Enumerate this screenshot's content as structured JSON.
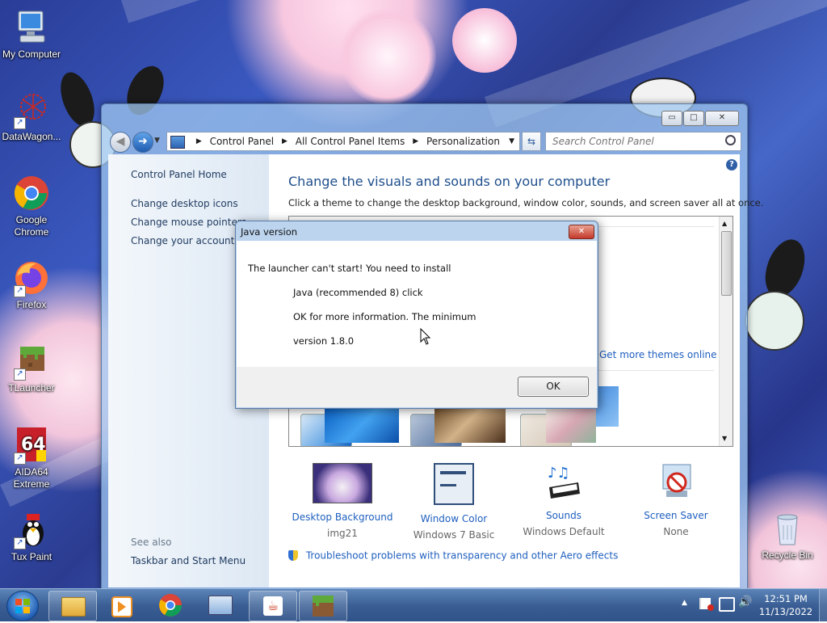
{
  "desktop": {
    "icons": [
      {
        "label": "My Computer",
        "icon": "computer-icon",
        "shortcut": false
      },
      {
        "label": "DataWagon...",
        "icon": "datawagon-icon",
        "shortcut": true
      },
      {
        "label": "Google Chrome",
        "icon": "chrome-icon",
        "shortcut": false
      },
      {
        "label": "Firefox",
        "icon": "firefox-icon",
        "shortcut": true
      },
      {
        "label": "TLauncher",
        "icon": "minecraft-block-icon",
        "shortcut": true
      },
      {
        "label": "AIDA64 Extreme",
        "icon": "aida64-icon",
        "shortcut": true
      },
      {
        "label": "Tux Paint",
        "icon": "tux-penguin-icon",
        "shortcut": true
      },
      {
        "label": "Recycle Bin",
        "icon": "recycle-bin-icon",
        "shortcut": false
      }
    ]
  },
  "window": {
    "breadcrumb": [
      "Control Panel",
      "All Control Panel Items",
      "Personalization"
    ],
    "search_placeholder": "Search Control Panel",
    "left_pane": {
      "home": "Control Panel Home",
      "links": [
        "Change desktop icons",
        "Change mouse pointers",
        "Change your account pi"
      ],
      "see_also_heading": "See also",
      "see_also": [
        "Taskbar and Start Menu"
      ]
    },
    "main": {
      "title": "Change the visuals and sounds on your computer",
      "subtitle": "Click a theme to change the desktop background, window color, sounds, and screen saver all at once.",
      "get_more_themes": "Get more themes online",
      "tools": [
        {
          "label": "Desktop Background",
          "value": "img21"
        },
        {
          "label": "Window Color",
          "value": "Windows 7 Basic"
        },
        {
          "label": "Sounds",
          "value": "Windows Default"
        },
        {
          "label": "Screen Saver",
          "value": "None"
        }
      ],
      "troubleshoot": "Troubleshoot problems with transparency and other Aero effects"
    }
  },
  "dialog": {
    "title": "Java version",
    "lines": [
      "The launcher can't start! You need to install",
      "Java (recommended 8) click",
      "OK for more information. The minimum",
      "version 1.8.0"
    ],
    "ok_label": "OK"
  },
  "taskbar": {
    "time": "12:51 PM",
    "date": "11/13/2022"
  },
  "colors": {
    "link": "#1f5fbf",
    "taskbar": "#3b5f95",
    "heading": "#1e4e8c"
  }
}
